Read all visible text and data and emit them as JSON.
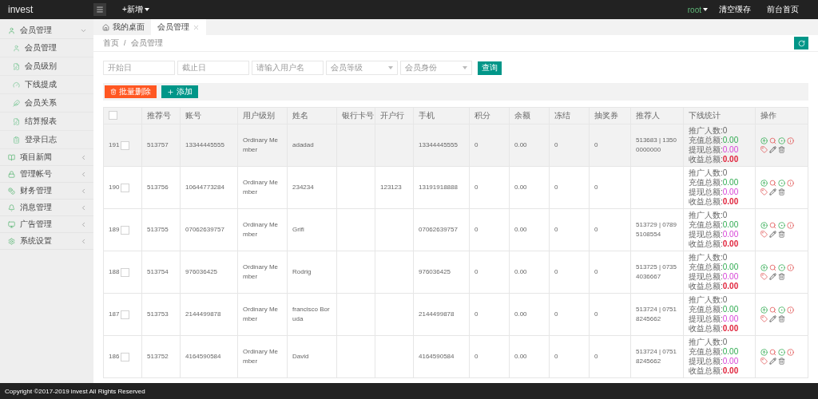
{
  "topbar": {
    "brand": "invest",
    "new_menu": "+新增",
    "user": "root",
    "links": [
      "清空缓存",
      "前台首页"
    ]
  },
  "sidebar": {
    "groups": [
      {
        "label": "会员管理",
        "expanded": true,
        "children": [
          {
            "label": "会员管理",
            "selected": false
          },
          {
            "label": "会员级别",
            "selected": false
          },
          {
            "label": "下线提成",
            "selected": false
          },
          {
            "label": "会员关系",
            "selected": false
          },
          {
            "label": "结算报表",
            "selected": false
          },
          {
            "label": "登录日志",
            "selected": false
          }
        ]
      },
      {
        "label": "项目新闻",
        "expanded": false
      },
      {
        "label": "管理帐号",
        "expanded": false
      },
      {
        "label": "财务管理",
        "expanded": false
      },
      {
        "label": "消息管理",
        "expanded": false
      },
      {
        "label": "广告管理",
        "expanded": false
      },
      {
        "label": "系统设置",
        "expanded": false
      }
    ]
  },
  "tabs": [
    {
      "label": "我的桌面",
      "selected": false,
      "closable": false
    },
    {
      "label": "会员管理",
      "selected": true,
      "closable": true
    }
  ],
  "breadcrumb": [
    {
      "kind": "link",
      "text": "首页"
    },
    {
      "kind": "separator",
      "text": "/"
    },
    {
      "kind": "current",
      "text": "会员管理"
    }
  ],
  "filters": [
    {
      "kind": "input",
      "placeholder": "开始日"
    },
    {
      "kind": "input",
      "placeholder": "截止日"
    },
    {
      "kind": "input",
      "placeholder": "请输入用户名"
    },
    {
      "kind": "select",
      "placeholder": "会员等级"
    },
    {
      "kind": "select",
      "placeholder": "会员身份"
    }
  ],
  "search_button": "查询",
  "actions": [
    {
      "kind": "delete",
      "label": "批量删除"
    },
    {
      "kind": "add",
      "label": "添加"
    }
  ],
  "table": {
    "select_all_checked": false,
    "columns": [
      "推荐号",
      "账号",
      "用户级别",
      "姓名",
      "银行卡号",
      "开户行",
      "手机",
      "积分",
      "余额",
      "冻结",
      "抽奖券",
      "推荐人",
      "下线统计",
      "操作"
    ],
    "rows": [
      {
        "id": "191",
        "selected": true,
        "checked": false,
        "cells": [
          "513757",
          "13344445555",
          "Ordinary Member",
          "adadad",
          "",
          "",
          "13344445555",
          "0",
          "0.00",
          "0",
          "0",
          "513683 | 13500000000"
        ],
        "stats": [
          {
            "kind": "count",
            "label": "推广人数:",
            "value": "0"
          },
          {
            "kind": "recharge",
            "label": "充值总额:",
            "value": "0.00"
          },
          {
            "kind": "withdraw",
            "label": "提现总额:",
            "value": "0.00"
          },
          {
            "kind": "income",
            "label": "收益总额:",
            "value": "0.00"
          }
        ]
      },
      {
        "id": "190",
        "selected": false,
        "checked": false,
        "cells": [
          "513756",
          "10644773284",
          "Ordinary Member",
          "234234",
          "",
          "123123",
          "13191918888",
          "0",
          "0.00",
          "0",
          "0",
          ""
        ],
        "stats": [
          {
            "kind": "count",
            "label": "推广人数:",
            "value": "0"
          },
          {
            "kind": "recharge",
            "label": "充值总额:",
            "value": "0.00"
          },
          {
            "kind": "withdraw",
            "label": "提现总额:",
            "value": "0.00"
          },
          {
            "kind": "income",
            "label": "收益总额:",
            "value": "0.00"
          }
        ]
      },
      {
        "id": "189",
        "selected": false,
        "checked": false,
        "cells": [
          "513755",
          "07062639757",
          "Ordinary Member",
          "Grifi",
          "",
          "",
          "07062639757",
          "0",
          "0.00",
          "0",
          "0",
          "513729 | 07895108554"
        ],
        "stats": [
          {
            "kind": "count",
            "label": "推广人数:",
            "value": "0"
          },
          {
            "kind": "recharge",
            "label": "充值总额:",
            "value": "0.00"
          },
          {
            "kind": "withdraw",
            "label": "提现总额:",
            "value": "0.00"
          },
          {
            "kind": "income",
            "label": "收益总额:",
            "value": "0.00"
          }
        ]
      },
      {
        "id": "188",
        "selected": false,
        "checked": false,
        "cells": [
          "513754",
          "976036425",
          "Ordinary Member",
          "Rodrig",
          "",
          "",
          "976036425",
          "0",
          "0.00",
          "0",
          "0",
          "513725 | 07354036667"
        ],
        "stats": [
          {
            "kind": "count",
            "label": "推广人数:",
            "value": "0"
          },
          {
            "kind": "recharge",
            "label": "充值总额:",
            "value": "0.00"
          },
          {
            "kind": "withdraw",
            "label": "提现总额:",
            "value": "0.00"
          },
          {
            "kind": "income",
            "label": "收益总额:",
            "value": "0.00"
          }
        ]
      },
      {
        "id": "187",
        "selected": false,
        "checked": false,
        "cells": [
          "513753",
          "2144499878",
          "Ordinary Member",
          "francisco Boruda",
          "",
          "",
          "2144499878",
          "0",
          "0.00",
          "0",
          "0",
          "513724 | 07518245662"
        ],
        "stats": [
          {
            "kind": "count",
            "label": "推广人数:",
            "value": "0"
          },
          {
            "kind": "recharge",
            "label": "充值总额:",
            "value": "0.00"
          },
          {
            "kind": "withdraw",
            "label": "提现总额:",
            "value": "0.00"
          },
          {
            "kind": "income",
            "label": "收益总额:",
            "value": "0.00"
          }
        ]
      },
      {
        "id": "186",
        "selected": false,
        "checked": false,
        "cells": [
          "513752",
          "4164590584",
          "Ordinary Member",
          "David",
          "",
          "",
          "4164590584",
          "0",
          "0.00",
          "0",
          "0",
          "513724 | 07518245662"
        ],
        "stats": [
          {
            "kind": "count",
            "label": "推广人数:",
            "value": "0"
          },
          {
            "kind": "recharge",
            "label": "充值总额:",
            "value": "0.00"
          },
          {
            "kind": "withdraw",
            "label": "提现总额:",
            "value": "0.00"
          },
          {
            "kind": "income",
            "label": "收益总额:",
            "value": "0.00"
          }
        ]
      }
    ]
  },
  "footer": "Copyright ©2017-2019 invest All Rights Reserved"
}
